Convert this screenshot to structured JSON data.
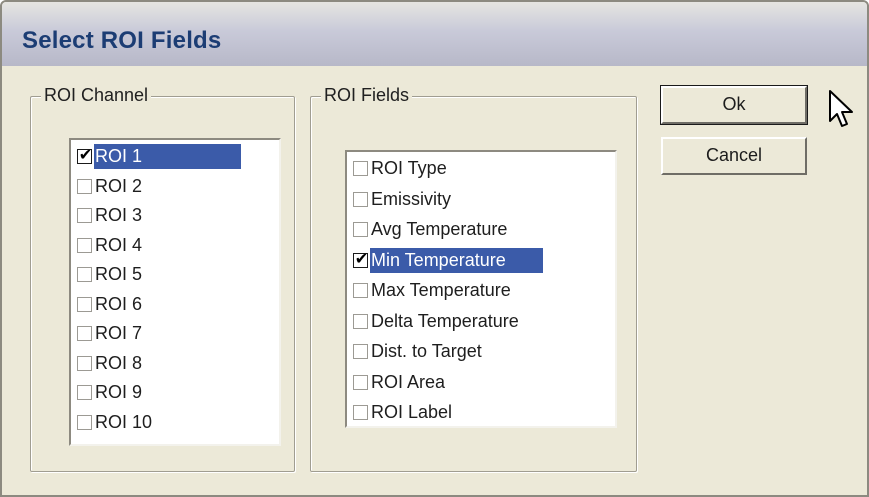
{
  "window": {
    "title": "Select ROI Fields"
  },
  "roi_channel": {
    "legend": "ROI Channel",
    "items": [
      {
        "label": "ROI 1",
        "checked": true,
        "selected": true
      },
      {
        "label": "ROI 2",
        "checked": false
      },
      {
        "label": "ROI 3",
        "checked": false
      },
      {
        "label": "ROI 4",
        "checked": false
      },
      {
        "label": "ROI 5",
        "checked": false
      },
      {
        "label": "ROI 6",
        "checked": false
      },
      {
        "label": "ROI 7",
        "checked": false
      },
      {
        "label": "ROI 8",
        "checked": false
      },
      {
        "label": "ROI 9",
        "checked": false
      },
      {
        "label": "ROI 10",
        "checked": false
      }
    ]
  },
  "roi_fields": {
    "legend": "ROI Fields",
    "items": [
      {
        "label": "ROI Type",
        "checked": false
      },
      {
        "label": "Emissivity",
        "checked": false
      },
      {
        "label": "Avg Temperature",
        "checked": false
      },
      {
        "label": "Min Temperature",
        "checked": true,
        "selected": true
      },
      {
        "label": "Max Temperature",
        "checked": false
      },
      {
        "label": "Delta Temperature",
        "checked": false
      },
      {
        "label": "Dist. to Target",
        "checked": false
      },
      {
        "label": "ROI Area",
        "checked": false
      },
      {
        "label": "ROI Label",
        "checked": false
      }
    ]
  },
  "buttons": {
    "ok_label": "Ok",
    "cancel_label": "Cancel"
  },
  "colors": {
    "selection": "#3b5ba9",
    "title_text": "#1c3d74",
    "dialog_bg": "#ece9d8"
  },
  "icons": {
    "check": "checkmark-icon",
    "pointer": "mouse-pointer-icon"
  }
}
